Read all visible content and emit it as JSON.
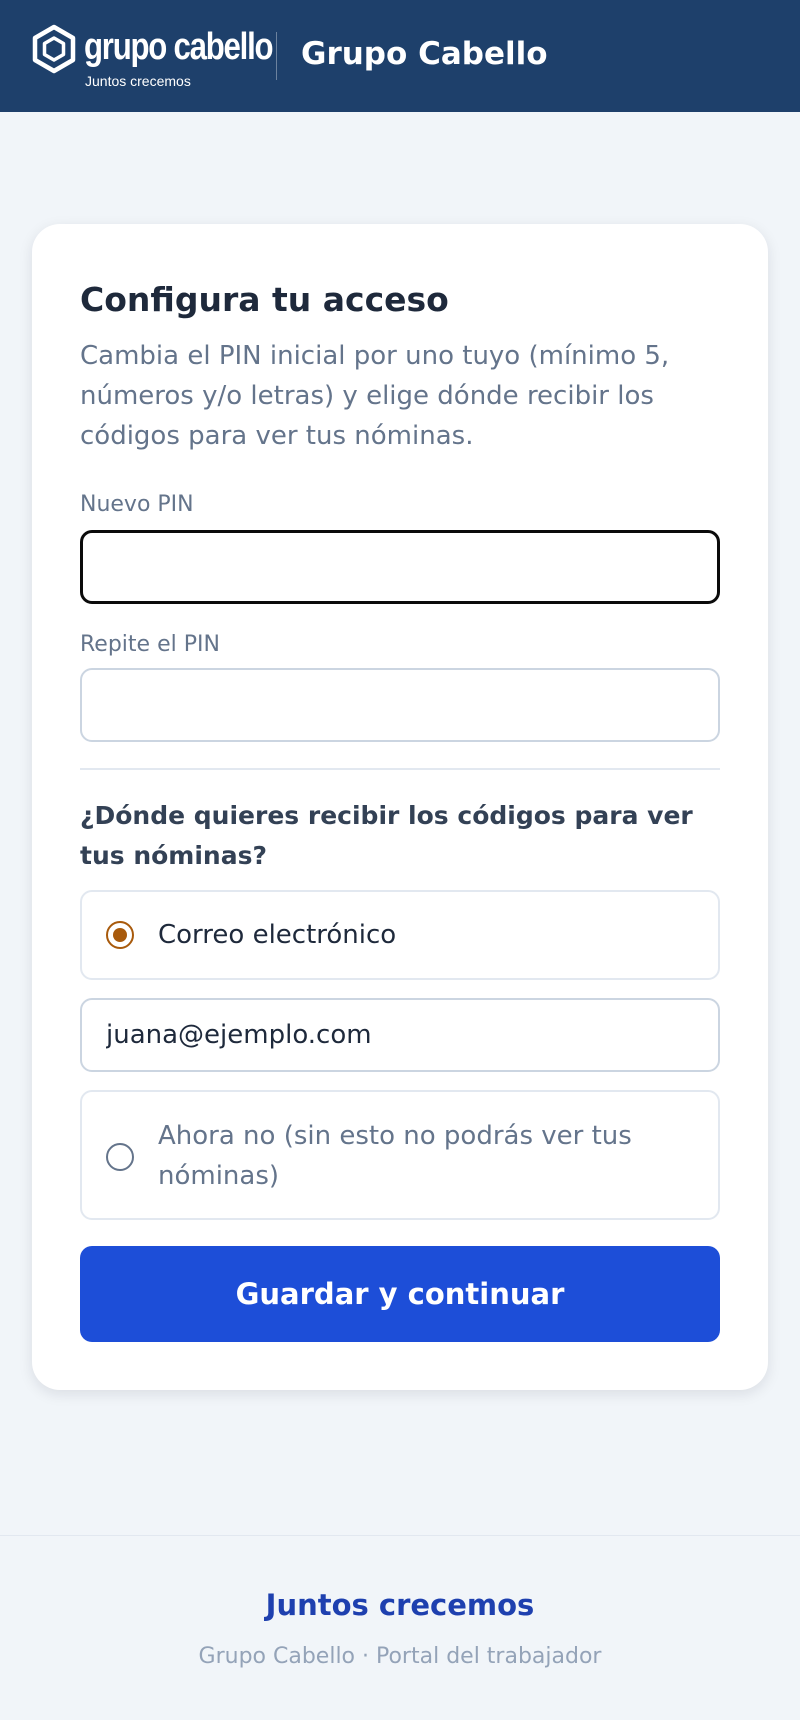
{
  "header": {
    "logo_name": "grupo cabello",
    "logo_tagline": "Juntos crecemos",
    "title": "Grupo Cabello"
  },
  "form": {
    "title": "Configura tu acceso",
    "description": "Cambia el PIN inicial por uno tuyo (mínimo 5, números y/o letras) y elige dónde recibir los códigos para ver tus nóminas.",
    "new_pin": {
      "label": "Nuevo PIN",
      "value": ""
    },
    "repeat_pin": {
      "label": "Repite el PIN",
      "value": ""
    },
    "question": "¿Dónde quieres recibir los códigos para ver tus nóminas?",
    "options": [
      {
        "label": "Correo electrónico",
        "selected": true
      },
      {
        "label": "Ahora no (sin esto no podrás ver tus nóminas)",
        "selected": false
      }
    ],
    "email_value": "juana@ejemplo.com",
    "submit_label": "Guardar y continuar"
  },
  "footer": {
    "motto": "Juntos crecemos",
    "subtitle": "Grupo Cabello · Portal del trabajador"
  },
  "colors": {
    "header_bg": "#1e406b",
    "primary_button": "#1d4ed8",
    "radio_accent": "#a85a0c",
    "footer_motto": "#1e40af"
  },
  "icons": {
    "logo": "hexagon-logo-icon"
  }
}
